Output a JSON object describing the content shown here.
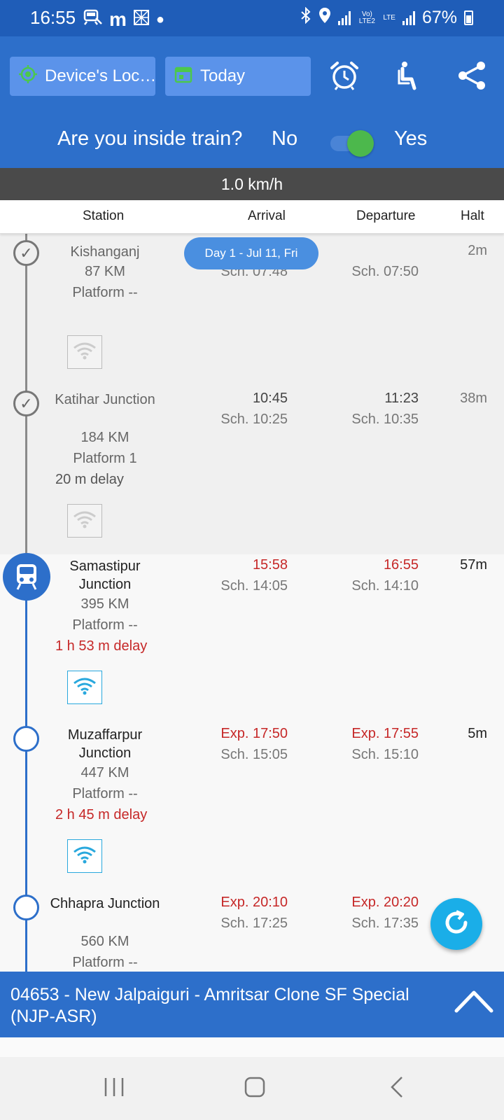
{
  "status_bar": {
    "time": "16:55",
    "battery": "67%",
    "network_lte2": "Vo) LTE2",
    "network_lte": "LTE"
  },
  "toolbar": {
    "location_label": "Device's Loc…",
    "date_label": "Today",
    "inside_question": "Are you inside train?",
    "no_label": "No",
    "yes_label": "Yes",
    "inside_train": true
  },
  "speed": "1.0 km/h",
  "columns": {
    "station": "Station",
    "arrival": "Arrival",
    "departure": "Departure",
    "halt": "Halt"
  },
  "day_chip": "Day 1 - Jul 11, Fri",
  "stops": [
    {
      "name": "Kishanganj",
      "km": "87 KM",
      "platform": "Platform --",
      "arrival": "",
      "arrival_sch": "Sch. 07:48",
      "departure": "",
      "departure_sch": "Sch. 07:50",
      "halt": "2m",
      "delay": "",
      "status": "passed"
    },
    {
      "name": "Katihar Junction",
      "km": "184 KM",
      "platform": "Platform 1",
      "arrival": "10:45",
      "arrival_sch": "Sch. 10:25",
      "departure": "11:23",
      "departure_sch": "Sch. 10:35",
      "halt": "38m",
      "delay": "20 m delay",
      "status": "passed"
    },
    {
      "name": "Samastipur Junction",
      "km": "395 KM",
      "platform": "Platform --",
      "arrival": "15:58",
      "arrival_sch": "Sch. 14:05",
      "departure": "16:55",
      "departure_sch": "Sch. 14:10",
      "halt": "57m",
      "delay": "1 h 53 m delay",
      "status": "current"
    },
    {
      "name": "Muzaffarpur Junction",
      "km": "447 KM",
      "platform": "Platform --",
      "arrival": "Exp. 17:50",
      "arrival_sch": "Sch. 15:05",
      "departure": "Exp. 17:55",
      "departure_sch": "Sch. 15:10",
      "halt": "5m",
      "delay": "2 h 45 m delay",
      "status": "upcoming"
    },
    {
      "name": "Chhapra Junction",
      "km": "560 KM",
      "platform": "Platform --",
      "arrival": "Exp. 20:10",
      "arrival_sch": "Sch. 17:25",
      "departure": "Exp. 20:20",
      "departure_sch": "Sch. 17:35",
      "halt": "",
      "delay": "",
      "status": "upcoming"
    }
  ],
  "train_title": "04653 - New Jalpaiguri - Amritsar Clone SF Special (NJP-ASR)",
  "colors": {
    "primary": "#2d6fca",
    "status_bar": "#1f5db8",
    "delay_red": "#c62828",
    "toggle_on": "#4cb84c",
    "fab": "#1aaee8"
  }
}
